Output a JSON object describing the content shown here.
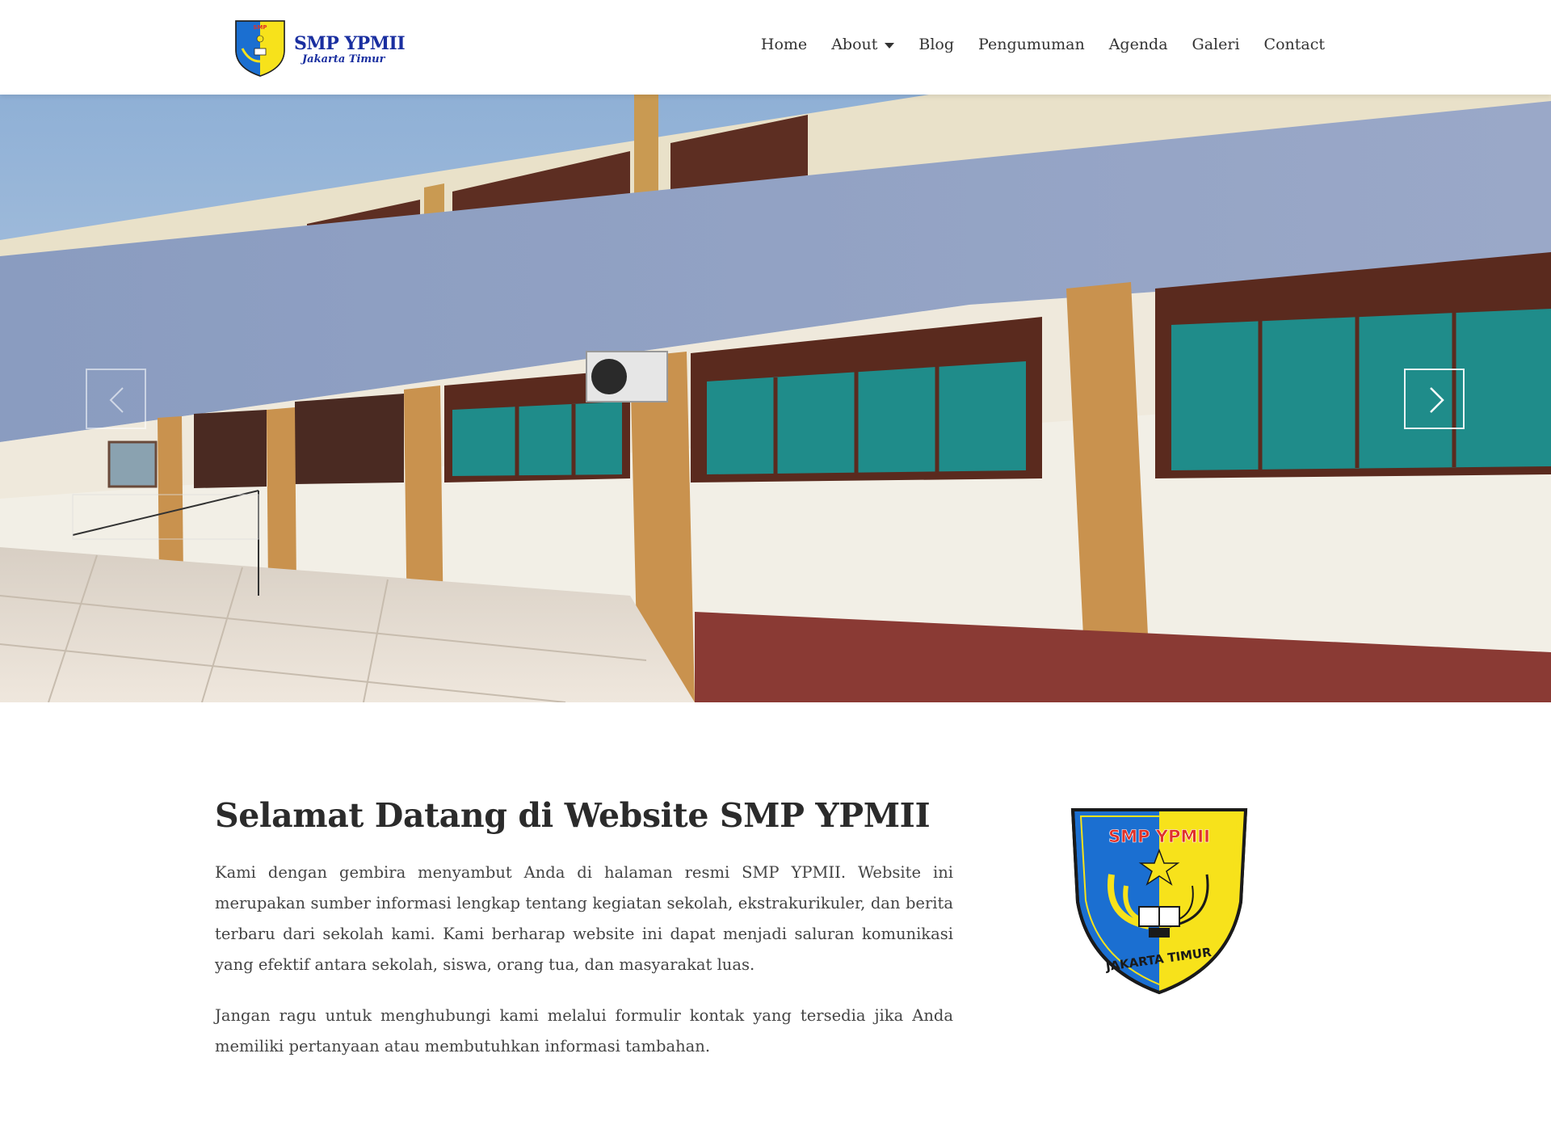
{
  "header": {
    "brand_title": "SMP YPMII",
    "brand_subtitle": "Jakarta Timur",
    "nav": [
      {
        "label": "Home"
      },
      {
        "label": "About",
        "has_dropdown": true
      },
      {
        "label": "Blog"
      },
      {
        "label": "Pengumuman"
      },
      {
        "label": "Agenda"
      },
      {
        "label": "Galeri"
      },
      {
        "label": "Contact"
      }
    ]
  },
  "hero": {
    "prev_icon": "chevron-left-icon",
    "next_icon": "chevron-right-icon"
  },
  "welcome": {
    "title": "Selamat Datang di Website SMP YPMII",
    "paragraph_1": "Kami dengan gembira menyambut Anda di halaman resmi SMP YPMII. Website ini merupakan sumber informasi lengkap tentang kegiatan sekolah, ekstrakurikuler, dan berita terbaru dari sekolah kami. Kami berharap website ini dapat menjadi saluran komunikasi yang efektif antara sekolah, siswa, orang tua, dan masyarakat luas.",
    "paragraph_2": "Jangan ragu untuk menghubungi kami melalui formulir kontak yang tersedia jika Anda memiliki pertanyaan atau membutuhkan informasi tambahan."
  },
  "crest": {
    "top_text": "SMP YPMII",
    "bottom_text": "JAKARTA TIMUR"
  },
  "colors": {
    "brand_blue": "#1a2fa0",
    "crest_blue": "#1b6fd1",
    "crest_yellow": "#f7e21b",
    "crest_red": "#e0322a"
  }
}
